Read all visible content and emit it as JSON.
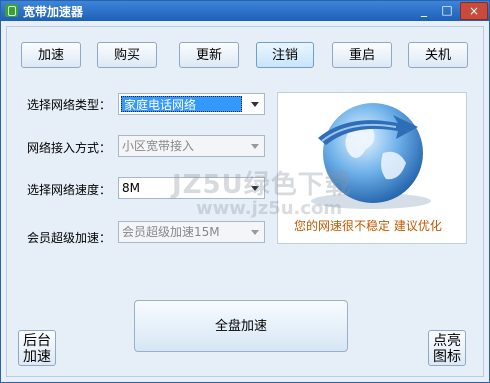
{
  "window": {
    "title": "宽带加速器",
    "min": "_",
    "max": "□",
    "close": "×"
  },
  "toolbar": [
    "加速",
    "购买",
    "更新",
    "注销",
    "重启",
    "关机"
  ],
  "form": {
    "network_type": {
      "label": "选择网络类型：",
      "value": "家庭电话网络"
    },
    "access_mode": {
      "label": "网络接入方式：",
      "value": "小区宽带接入"
    },
    "speed": {
      "label": "选择网络速度：",
      "value": "8M"
    },
    "member": {
      "label": "会员超级加速：",
      "value": "会员超级加速15M"
    }
  },
  "panel": {
    "message": "您的网速很不稳定  建议优化"
  },
  "actions": {
    "full_accelerate": "全盘加速",
    "background_line1": "后台",
    "background_line2": "加速",
    "tray_line1": "点亮",
    "tray_line2": "图标"
  },
  "watermark": {
    "line1": "JZ5U绿色下载",
    "line2": "www.jz5u.com"
  }
}
